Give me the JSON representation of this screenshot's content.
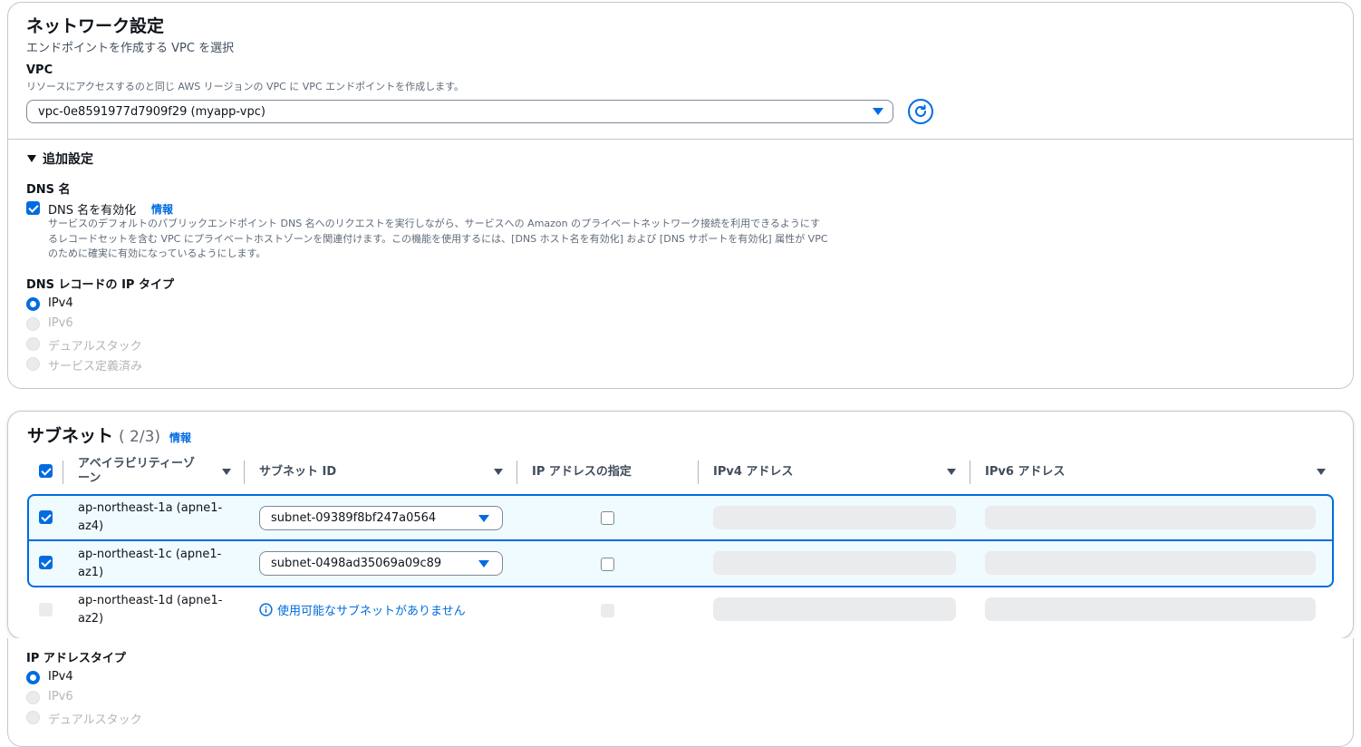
{
  "network": {
    "title": "ネットワーク設定",
    "description": "エンドポイントを作成する VPC を選択",
    "vpc_label": "VPC",
    "vpc_help": "リソースにアクセスするのと同じ AWS リージョンの VPC に VPC エンドポイントを作成します。",
    "vpc_value": "vpc-0e8591977d7909f29 (myapp-vpc)"
  },
  "additional": {
    "toggle_label": "追加設定",
    "dns_name_label": "DNS 名",
    "dns_enable_label": "DNS 名を有効化",
    "info_link": "情報",
    "dns_help_1": "サービスのデフォルトのパブリックエンドポイント DNS 名へのリクエストを実行しながら、サービスへの Amazon のプライベートネットワーク接続を利用できるようにす",
    "dns_help_2": "るレコードセットを含む VPC にプライベートホストゾーンを関連付けます。この機能を使用するには、[DNS ホスト名を有効化] および [DNS サポートを有効化] 属性が VPC",
    "dns_help_3": "のために確実に有効になっているようにします。",
    "dns_record_label": "DNS レコードの IP タイプ",
    "dns_record_options": [
      "IPv4",
      "IPv6",
      "デュアルスタック",
      "サービス定義済み"
    ]
  },
  "subnets": {
    "title": "サブネット",
    "count": "( 2/3)",
    "info_link": "情報",
    "columns": {
      "az": "アベイラビリティーゾ",
      "az_wrap": "ーン",
      "subnet_id": "サブネット ID",
      "ip_spec": "IP アドレスの指定",
      "ipv4": "IPv4 アドレス",
      "ipv6": "IPv6 アドレス"
    },
    "rows": [
      {
        "az_1": "ap-northeast-1a (apne1-",
        "az_2": "az4)",
        "subnet": "subnet-09389f8bf247a0564"
      },
      {
        "az_1": "ap-northeast-1c (apne1-",
        "az_2": "az1)",
        "subnet": "subnet-0498ad35069a09c89"
      },
      {
        "az_1": "ap-northeast-1d (apne1-",
        "az_2": "az2)",
        "no_subnet": "使用可能なサブネットがありません"
      }
    ]
  },
  "ip_address_type": {
    "label": "IP アドレスタイプ",
    "options": [
      "IPv4",
      "IPv6",
      "デュアルスタック"
    ]
  },
  "colors": {
    "accent": "#006ce0",
    "selected_row_bg": "#f0fbff",
    "disabled": "#b4b4bb"
  }
}
